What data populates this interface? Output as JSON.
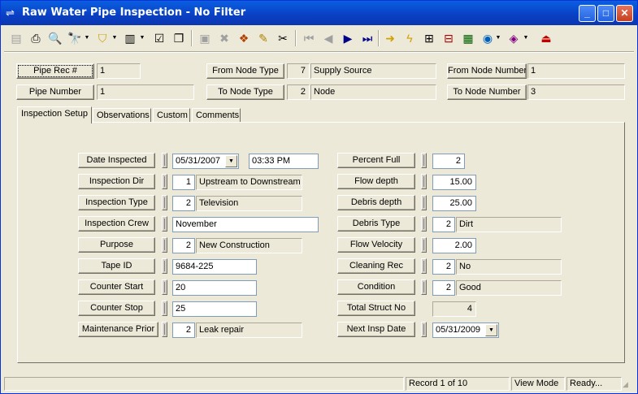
{
  "window": {
    "title": "Raw Water Pipe Inspection - No Filter",
    "controls": {
      "minimize": "_",
      "maximize": "□",
      "close": "✕"
    }
  },
  "header": {
    "pipe_rec_label": "Pipe Rec #",
    "pipe_rec_value": "1",
    "pipe_number_label": "Pipe Number",
    "pipe_number_value": "1",
    "from_node_type_label": "From Node Type",
    "from_node_type_code": "7",
    "from_node_type_value": "Supply Source",
    "to_node_type_label": "To Node Type",
    "to_node_type_code": "2",
    "to_node_type_value": "Node",
    "from_node_number_label": "From Node Number",
    "from_node_number_value": "1",
    "to_node_number_label": "To Node Number",
    "to_node_number_value": "3"
  },
  "tabs": [
    {
      "label": "Inspection Setup"
    },
    {
      "label": "Observations"
    },
    {
      "label": "Custom"
    },
    {
      "label": "Comments"
    }
  ],
  "left": {
    "date_inspected_label": "Date Inspected",
    "date_inspected_value": "05/31/2007",
    "time_inspected_value": "03:33 PM",
    "inspection_dir_label": "Inspection Dir",
    "inspection_dir_code": "1",
    "inspection_dir_value": "Upstream to Downstream",
    "inspection_type_label": "Inspection Type",
    "inspection_type_code": "2",
    "inspection_type_value": "Television",
    "inspection_crew_label": "Inspection Crew",
    "inspection_crew_value": "November",
    "purpose_label": "Purpose",
    "purpose_code": "2",
    "purpose_value": "New Construction",
    "tape_id_label": "Tape ID",
    "tape_id_value": "9684-225",
    "counter_start_label": "Counter Start",
    "counter_start_value": "20",
    "counter_stop_label": "Counter Stop",
    "counter_stop_value": "25",
    "maintenance_prior_label": "Maintenance Prior",
    "maintenance_prior_code": "2",
    "maintenance_prior_value": "Leak repair"
  },
  "right": {
    "percent_full_label": "Percent Full",
    "percent_full_value": "2",
    "flow_depth_label": "Flow depth",
    "flow_depth_value": "15.00",
    "debris_depth_label": "Debris depth",
    "debris_depth_value": "25.00",
    "debris_type_label": "Debris Type",
    "debris_type_code": "2",
    "debris_type_value": "Dirt",
    "flow_velocity_label": "Flow Velocity",
    "flow_velocity_value": "2.00",
    "cleaning_rec_label": "Cleaning Rec",
    "cleaning_rec_code": "2",
    "cleaning_rec_value": "No",
    "condition_label": "Condition",
    "condition_code": "2",
    "condition_value": "Good",
    "total_struct_no_label": "Total Struct No",
    "total_struct_no_value": "4",
    "next_insp_date_label": "Next Insp Date",
    "next_insp_date_value": "05/31/2009"
  },
  "status": {
    "record": "Record 1 of 10",
    "mode": "View Mode",
    "state": "Ready..."
  },
  "toolbar_icons": [
    "new-icon",
    "print-icon",
    "preview-icon",
    "find-icon",
    "filter-icon",
    "report-icon",
    "properties-icon",
    "copy-icon",
    "save-icon",
    "delete-icon",
    "stack-icon",
    "edit-icon",
    "cut-icon",
    "first-record-icon",
    "prev-record-icon",
    "next-record-icon",
    "last-record-icon",
    "arrow-jump-icon",
    "lightning-icon",
    "map-icon",
    "tree-icon",
    "image-icon",
    "globe-icon",
    "book-icon",
    "exit-icon"
  ]
}
